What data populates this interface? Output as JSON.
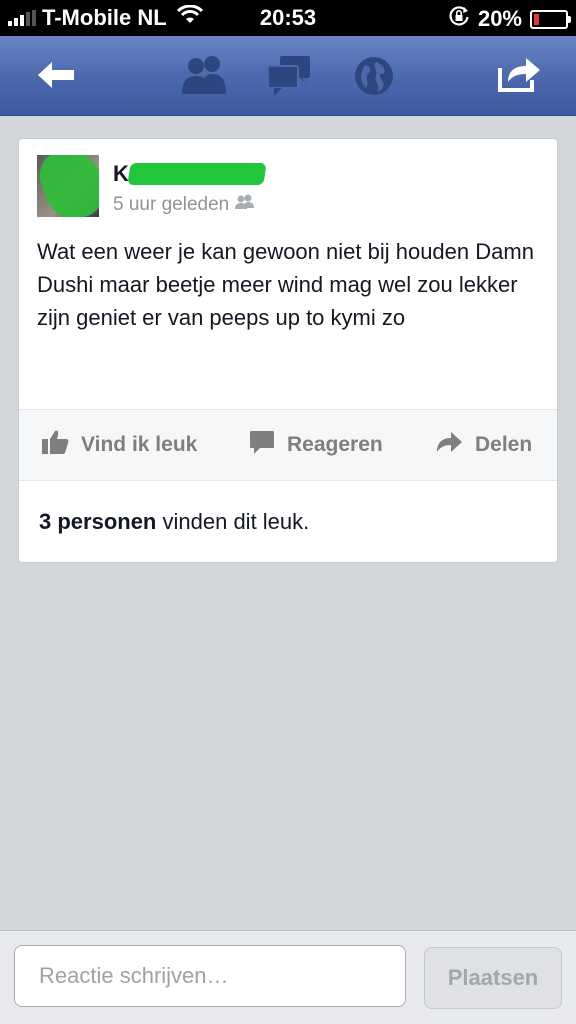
{
  "status_bar": {
    "carrier": "T-Mobile NL",
    "time": "20:53",
    "battery_percent": "20%",
    "battery_level": 0.2,
    "battery_color": "#e63b2e"
  },
  "nav": {
    "icons": [
      "back-arrow-icon",
      "friend-requests-icon",
      "messages-icon",
      "notifications-globe-icon",
      "share-icon"
    ],
    "bar_color": "#4b67ad"
  },
  "post": {
    "author_visible_initial": "K",
    "timestamp": "5 uur geleden",
    "audience_icon": "friends-icon",
    "text": "Wat een weer je kan gewoon niet bij houden Damn Dushi maar beetje meer wind mag wel zou lekker zijn geniet er van peeps up to kymi zo",
    "actions": {
      "like": "Vind ik leuk",
      "comment": "Reageren",
      "share": "Delen"
    },
    "likes": {
      "count_text": "3 personen",
      "suffix": "vinden dit leuk."
    }
  },
  "composer": {
    "placeholder": "Reactie schrijven…",
    "value": "",
    "submit_label": "Plaatsen"
  }
}
